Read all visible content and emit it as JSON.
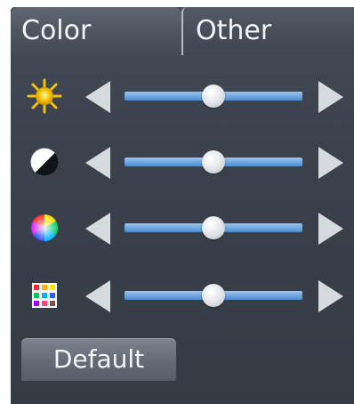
{
  "tabs": [
    {
      "label": "Color",
      "active": true
    },
    {
      "label": "Other",
      "active": false
    }
  ],
  "sliders": [
    {
      "name": "brightness",
      "icon": "sun-icon",
      "value_fraction": 0.5
    },
    {
      "name": "contrast",
      "icon": "contrast-icon",
      "value_fraction": 0.5
    },
    {
      "name": "saturation",
      "icon": "color-wheel-icon",
      "value_fraction": 0.5
    },
    {
      "name": "hue",
      "icon": "color-grid-icon",
      "value_fraction": 0.5
    }
  ],
  "buttons": {
    "default_label": "Default"
  },
  "colors": {
    "track": "#6aa3df",
    "panel": "#3b424d",
    "arrow": "#d6d9dd"
  }
}
